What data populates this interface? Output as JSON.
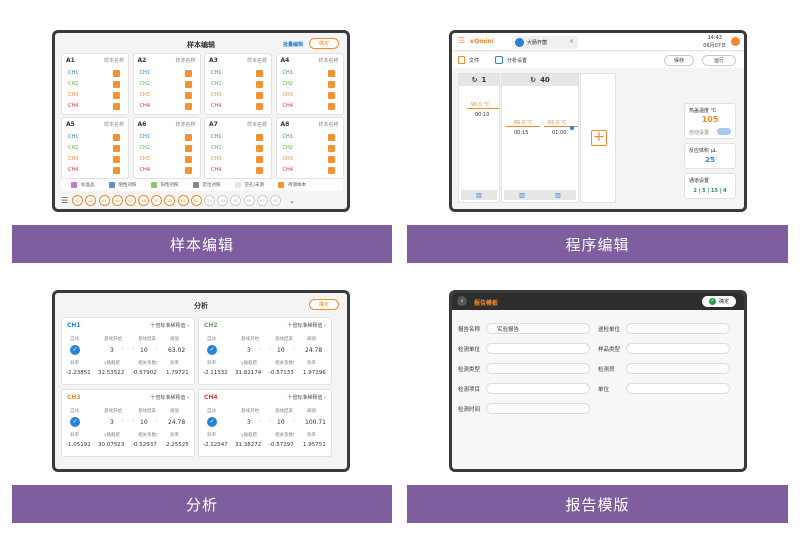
{
  "panel1": {
    "title": "样本编辑",
    "batch_edit": "批量编辑",
    "confirm": "确定",
    "col_header": "样本名称",
    "cards": [
      "A1",
      "A2",
      "A3",
      "A4",
      "A5",
      "A6",
      "A7",
      "A8"
    ],
    "channels": [
      {
        "label": "CH1",
        "color": "#2a82d6"
      },
      {
        "label": "CH2",
        "color": "#6aa84f"
      },
      {
        "label": "CH3",
        "color": "#f08a2c"
      },
      {
        "label": "CH4",
        "color": "#e03a3a"
      }
    ],
    "legend": [
      {
        "label": "标准品",
        "color": "#c27bd1"
      },
      {
        "label": "阴性对照",
        "color": "#5b8fd8"
      },
      {
        "label": "阳性对照",
        "color": "#8bc86a"
      },
      {
        "label": "定位对照",
        "color": "#888888"
      },
      {
        "label": "空孔/未测",
        "color": "#e5e5e5"
      },
      {
        "label": "待测样本",
        "color": "#f29233"
      }
    ],
    "wells_on": [
      "A1",
      "A2",
      "A3",
      "A4",
      "A5",
      "A6",
      "A7",
      "A8",
      "B1",
      "B2"
    ],
    "wells_off": [
      "B3",
      "B4",
      "B5",
      "B6",
      "B7",
      "B8"
    ]
  },
  "panel2": {
    "brand": "eQmini",
    "tab": "大肠杆菌",
    "time": "14:43",
    "date": "06月07日",
    "file": "文件",
    "analysis": "分析设置",
    "save": "保存",
    "run": "运行",
    "step1": "1",
    "step2": "40",
    "s1_temp": "90.0 ℃",
    "s1_time": "00:10",
    "s2a_temp": "65.0 ℃",
    "s2a_time": "00:15",
    "s2b_temp": "65.0 ℃",
    "s2b_time": "01:00",
    "lid_label": "热盖温度 ℃",
    "lid_value": "105",
    "auto_label": "自动设置",
    "vol_label": "反应体积 μL",
    "vol_value": "25",
    "channel_label": "通道设置",
    "channel_value": "2 | 5 | 15 | 4"
  },
  "panel3": {
    "title": "分析",
    "confirm": "确定",
    "head_labels": [
      "自动",
      "基线开始",
      "基线结束",
      "阈值"
    ],
    "foot_labels": [
      "斜率",
      "y轴截距",
      "相关系数r",
      "效率"
    ],
    "cards": [
      {
        "ch": "CH1",
        "color": "#2a82d6",
        "std": "十倍标准稀释值",
        "start": "3",
        "end": "10",
        "thr": "63.02",
        "slope": "-2.23851",
        "yint": "32.53522",
        "r": "-0.57902",
        "eff": "1.79721"
      },
      {
        "ch": "CH2",
        "color": "#6aa84f",
        "std": "十倍标准稀释值",
        "start": "3",
        "end": "10",
        "thr": "24.78",
        "slope": "-2.11332",
        "yint": "31.82174",
        "r": "-0.57133",
        "eff": "1.97296"
      },
      {
        "ch": "CH3",
        "color": "#f08a2c",
        "std": "十倍标准稀释值",
        "start": "3",
        "end": "10",
        "thr": "24.78",
        "slope": "-1.05192",
        "yint": "30.07523",
        "r": "-0.52937",
        "eff": "2.25525"
      },
      {
        "ch": "CH4",
        "color": "#e03a3a",
        "std": "十倍标准稀释值",
        "start": "3",
        "end": "10",
        "thr": "100.71",
        "slope": "-2.12347",
        "yint": "31.38272",
        "r": "-0.57297",
        "eff": "1.95751"
      }
    ]
  },
  "panel4": {
    "title": "报告模板",
    "confirm": "确定",
    "fields_left": [
      {
        "label": "报告名称",
        "value": "实验报告"
      },
      {
        "label": "检测单位",
        "value": ""
      },
      {
        "label": "检测类型",
        "value": ""
      },
      {
        "label": "检测项目",
        "value": ""
      },
      {
        "label": "检测时间",
        "value": ""
      }
    ],
    "fields_right": [
      {
        "label": "送检单位",
        "value": ""
      },
      {
        "label": "样品类型",
        "value": ""
      },
      {
        "label": "检测员",
        "value": ""
      },
      {
        "label": "单位",
        "value": ""
      }
    ]
  },
  "captions": [
    "样本编辑",
    "程序编辑",
    "分析",
    "报告模版"
  ]
}
